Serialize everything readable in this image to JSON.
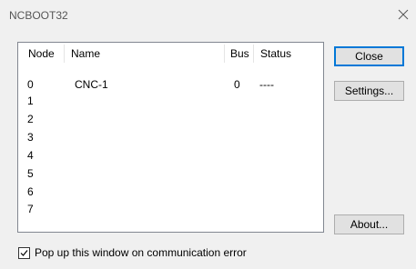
{
  "window": {
    "title": "NCBOOT32"
  },
  "list": {
    "columns": {
      "node": "Node",
      "name": "Name",
      "bus": "Bus",
      "status": "Status"
    },
    "rows": [
      {
        "node": "0",
        "name": "CNC-1",
        "bus": "0",
        "status": "----"
      },
      {
        "node": "1",
        "name": "",
        "bus": "",
        "status": ""
      },
      {
        "node": "2",
        "name": "",
        "bus": "",
        "status": ""
      },
      {
        "node": "3",
        "name": "",
        "bus": "",
        "status": ""
      },
      {
        "node": "4",
        "name": "",
        "bus": "",
        "status": ""
      },
      {
        "node": "5",
        "name": "",
        "bus": "",
        "status": ""
      },
      {
        "node": "6",
        "name": "",
        "bus": "",
        "status": ""
      },
      {
        "node": "7",
        "name": "",
        "bus": "",
        "status": ""
      }
    ]
  },
  "buttons": {
    "close": "Close",
    "settings": "Settings...",
    "about": "About..."
  },
  "options": {
    "popup_on_error_label": "Pop up this window on communication error",
    "popup_on_error_checked": true
  },
  "icons": {
    "close": "close-icon",
    "checkmark": "checkmark-icon"
  },
  "colors": {
    "accent": "#0078d7",
    "window_bg": "#f0f0f0",
    "list_bg": "#ffffff"
  }
}
